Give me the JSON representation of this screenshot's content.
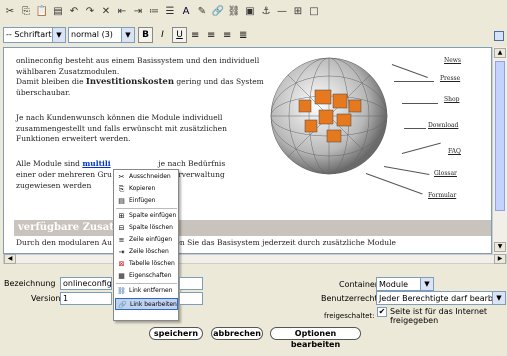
{
  "toolbar": {
    "icons": [
      "cut-icon",
      "copy-icon",
      "paste-icon",
      "paste-word-icon",
      "undo-icon",
      "redo-icon",
      "remove-format-icon",
      "outdent-icon",
      "indent-icon",
      "ordered-list-icon",
      "unordered-list-icon",
      "text-color-icon",
      "draw-icon",
      "link-icon",
      "unlink-icon",
      "image-icon",
      "anchor-icon",
      "hr-icon",
      "table-icon",
      "table-props-icon"
    ]
  },
  "format": {
    "font_select": "-- Schriftart --",
    "size_select": "normal (3)",
    "bold": "B",
    "italic": "I",
    "underline": "U"
  },
  "content": {
    "p1": "onlineconfig besteht aus einem Basissystem und den individuell wählbaren Zusatzmodulen.",
    "p2a": "Damit bleiben die ",
    "p2b": "Investitionskosten",
    "p2c": " gering und das System überschaubar.",
    "p3": "Je nach Kundenwunsch können die Module individuell zusammengestellt und falls erwünscht mit zusätzlichen Funktionen erweitert werden.",
    "p4a": "Alle Module sind ",
    "p4b": "multili",
    "p4c": "                    je nach Bedürfnis",
    "p4d": "einer oder mehreren Gru                     utzerverwaltung",
    "p4e": "zugewiesen werden",
    "heading": "verfügbare Zusatzm",
    "p5": "Durch den modularen Au                    onfig CMS können Sie das Basisystem jederzeit durch zusätzliche Module",
    "links": [
      "News",
      "Presse",
      "Shop",
      "Download",
      "FAQ",
      "Glossar",
      "Formular"
    ]
  },
  "context_menu": {
    "items": [
      "Ausschneiden",
      "Kopieren",
      "Einfügen",
      "Spalte einfügen",
      "Spalte löschen",
      "Zeile einfügen",
      "Zeile löschen",
      "Tabelle löschen",
      "Eigenschaften",
      "Link entfernen",
      "Link bearbeiten"
    ],
    "highlighted": "Link bearbeiten"
  },
  "form": {
    "bezeichnung_label": "Bezeichnung",
    "bezeichnung_value": "onlineconfig Cf",
    "version_label": "Version",
    "version_value": "1",
    "container_label": "Container",
    "container_value": "Module",
    "benutzerrecht_label": "Benutzerrecht",
    "benutzerrecht_value": "Jeder Berechtigte darf bearbeiten",
    "freigeschaltet_label": "freigeschaltet:",
    "freigeschaltet_text": "Seite ist für das Internet freigegeben",
    "freigeschaltet_checked": true
  },
  "buttons": {
    "save": "speichern",
    "cancel": "abbrechen",
    "options": "Optionen bearbeiten"
  }
}
